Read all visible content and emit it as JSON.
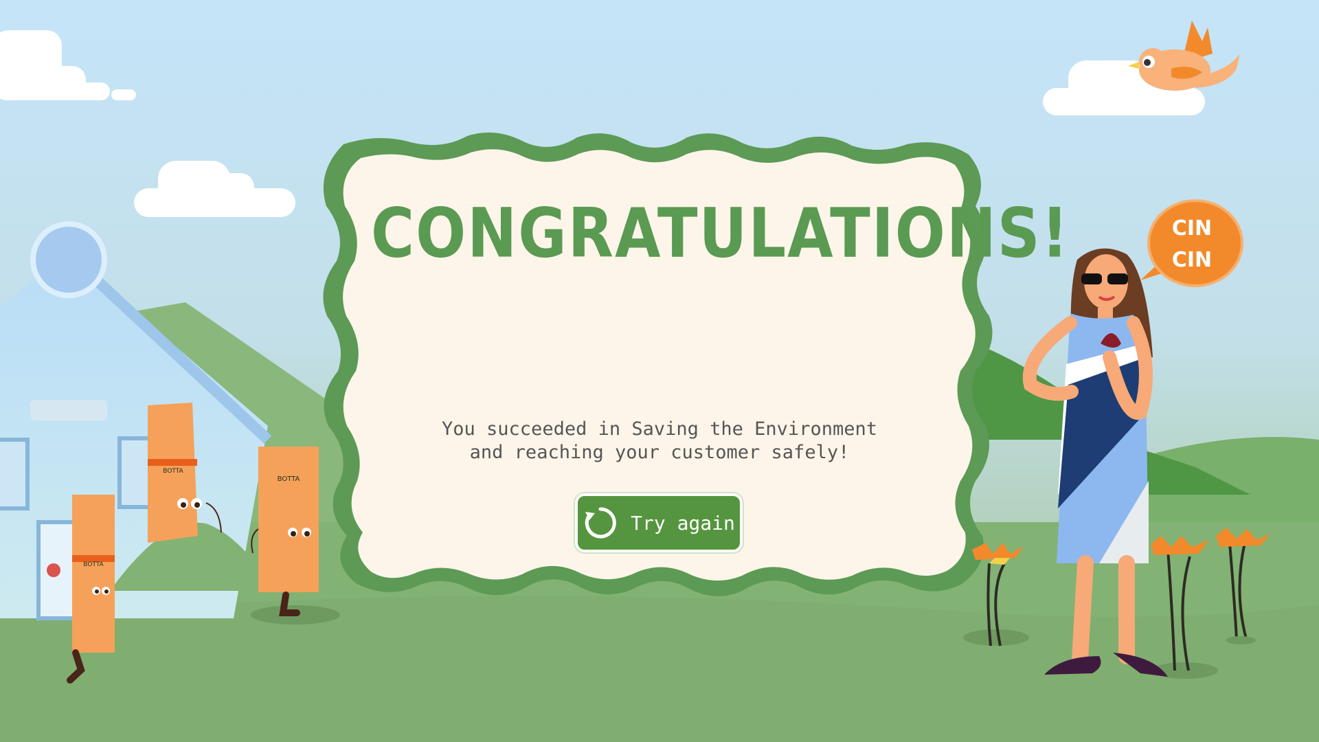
{
  "dialog": {
    "title": "CONGRATULATIONS!",
    "message": "You succeeded in Saving the Environment\nand reaching your customer safely!",
    "try_again_label": "Try again"
  },
  "speech_bubble": {
    "line1": "CIN",
    "line2": "CIN"
  },
  "box_brand": "BOTTA",
  "colors": {
    "sky_top": "#c5e4f8",
    "sky_bottom": "#a9cfa4",
    "grass": "#82b274",
    "hill_dark": "#4f9645",
    "frame_green": "#5c9a55",
    "panel_cream": "#fdf5e9",
    "button_green": "#55953f",
    "box_orange": "#f5a15a",
    "bubble_orange": "#f28a2c"
  },
  "icons": [
    "refresh-icon",
    "bird-icon",
    "cloud-icon",
    "flower-icon",
    "house-icon"
  ]
}
